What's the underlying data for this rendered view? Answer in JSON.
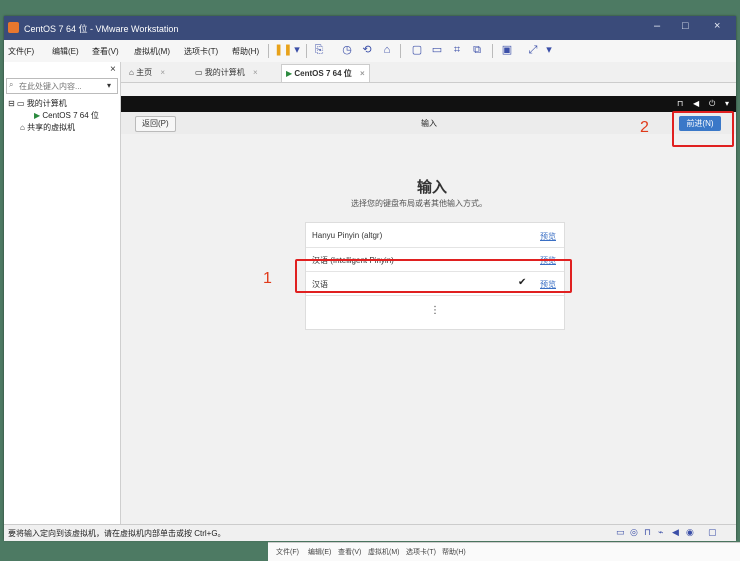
{
  "window": {
    "title": "CentOS 7 64 位 - VMware Workstation",
    "controls": [
      "–",
      "□",
      "×"
    ]
  },
  "menu": {
    "file": "文件(F)",
    "edit": "编辑(E)",
    "view": "查看(V)",
    "vm": "虚拟机(M)",
    "tabs": "选项卡(T)",
    "help": "帮助(H)"
  },
  "toolbar_icons": [
    "pause-icon",
    "dropdown-icon",
    "send-keys-icon",
    "snapshot-icon",
    "revert-icon",
    "manage-snapshots-icon",
    "fullscreen-icon",
    "unity-icon",
    "stretch-icon",
    "autofit-icon",
    "console-icon",
    "view-icon",
    "dropdown-icon"
  ],
  "library": {
    "close": "×",
    "search_placeholder": "在此处键入内容...",
    "items": [
      "我的计算机",
      "CentOS 7 64 位",
      "共享的虚拟机"
    ]
  },
  "tabs": [
    {
      "label": "主页",
      "close": "×"
    },
    {
      "label": "我的计算机",
      "close": "×"
    },
    {
      "label": "CentOS 7 64 位",
      "close": "×"
    }
  ],
  "vm": {
    "back": "返回(P)",
    "header_title": "输入",
    "next": "前进(N)",
    "heading": "输入",
    "subheading": "选择您的键盘布局或者其他输入方式。",
    "options": [
      {
        "label": "Hanyu Pinyin (altgr)",
        "preview": "预览",
        "selected": false
      },
      {
        "label": "汉语 (Intelligent Pinyin)",
        "preview": "预览",
        "selected": false
      },
      {
        "label": "汉语",
        "preview": "预览",
        "selected": true
      }
    ],
    "more": "⋮"
  },
  "annotations": {
    "one": "1",
    "two": "2",
    "color": "#e02020"
  },
  "status": {
    "message": "要将输入定向到该虚拟机，请在虚拟机内部单击或按 Ctrl+G。"
  },
  "taskbar": {
    "items": [
      "文件(F)",
      "编辑(E)",
      "查看(V)",
      "虚拟机(M)",
      "选项卡(T)",
      "帮助(H)"
    ]
  }
}
